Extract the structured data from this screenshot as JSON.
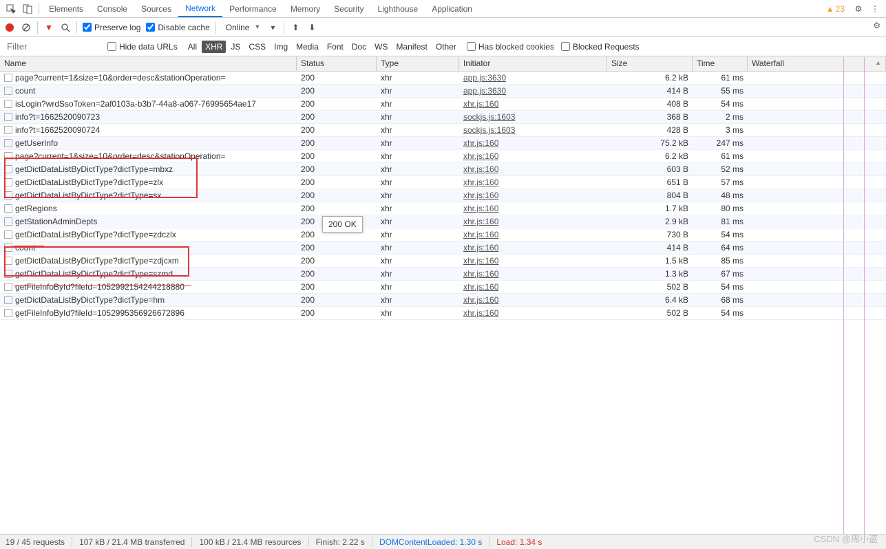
{
  "tabs": {
    "elements": "Elements",
    "console": "Console",
    "sources": "Sources",
    "network": "Network",
    "performance": "Performance",
    "memory": "Memory",
    "security": "Security",
    "lighthouse": "Lighthouse",
    "application": "Application"
  },
  "warnCount": "23",
  "toolbar": {
    "preserve": "Preserve log",
    "disable": "Disable cache",
    "throttle": "Online"
  },
  "filter": {
    "placeholder": "Filter",
    "hideUrls": "Hide data URLs",
    "types": [
      "All",
      "XHR",
      "JS",
      "CSS",
      "Img",
      "Media",
      "Font",
      "Doc",
      "WS",
      "Manifest",
      "Other"
    ],
    "blockedCookies": "Has blocked cookies",
    "blockedRequests": "Blocked Requests"
  },
  "headers": {
    "name": "Name",
    "status": "Status",
    "type": "Type",
    "initiator": "Initiator",
    "size": "Size",
    "time": "Time",
    "waterfall": "Waterfall"
  },
  "rows": [
    {
      "name": "page?current=1&size=10&order=desc&stationOperation=",
      "status": "200",
      "type": "xhr",
      "initiator": "app.js:3630",
      "size": "6.2 kB",
      "time": "61 ms",
      "wfLeft": 4,
      "wfW": 4
    },
    {
      "name": "count",
      "status": "200",
      "type": "xhr",
      "initiator": "app.js:3630",
      "size": "414 B",
      "time": "55 ms",
      "wfLeft": 4,
      "wfW": 3
    },
    {
      "name": "isLogin?wrdSsoToken=2af0103a-b3b7-44a8-a067-76995654ae17",
      "status": "200",
      "type": "xhr",
      "initiator": "xhr.js:160",
      "size": "408 B",
      "time": "54 ms",
      "wfLeft": 4,
      "wfW": 3
    },
    {
      "name": "info?t=1662520090723",
      "status": "200",
      "type": "xhr",
      "initiator": "sockjs.js:1603",
      "size": "368 B",
      "time": "2 ms",
      "wfLeft": 4,
      "wfW": 2
    },
    {
      "name": "info?t=1662520090724",
      "status": "200",
      "type": "xhr",
      "initiator": "sockjs.js:1603",
      "size": "428 B",
      "time": "3 ms",
      "wfLeft": 4,
      "wfW": 2
    },
    {
      "name": "getUserInfo",
      "status": "200",
      "type": "xhr",
      "initiator": "xhr.js:160",
      "size": "75.2 kB",
      "time": "247 ms",
      "wfLeft": 158,
      "wfW": 6
    },
    {
      "name": "page?current=1&size=10&order=desc&stationOperation=",
      "status": "200",
      "type": "xhr",
      "initiator": "xhr.js:160",
      "size": "6.2 kB",
      "time": "61 ms",
      "wfLeft": 176,
      "wfW": 3
    },
    {
      "name": "getDictDataListByDictType?dictType=mbxz",
      "status": "200",
      "type": "xhr",
      "initiator": "xhr.js:160",
      "size": "603 B",
      "time": "52 ms",
      "wfLeft": 176,
      "wfW": 3
    },
    {
      "name": "getDictDataListByDictType?dictType=zlx",
      "status": "200",
      "type": "xhr",
      "initiator": "xhr.js:160",
      "size": "651 B",
      "time": "57 ms",
      "wfLeft": 176,
      "wfW": 3
    },
    {
      "name": "getDictDataListByDictType?dictType=sx",
      "status": "200",
      "type": "xhr",
      "initiator": "xhr.js:160",
      "size": "804 B",
      "time": "48 ms",
      "wfLeft": 176,
      "wfW": 3
    },
    {
      "name": "getRegions",
      "status": "200",
      "type": "xhr",
      "initiator": "xhr.js:160",
      "size": "1.7 kB",
      "time": "80 ms",
      "wfLeft": 176,
      "wfW": 3
    },
    {
      "name": "getStationAdminDepts",
      "status": "200",
      "type": "xhr",
      "initiator": "xhr.js:160",
      "size": "2.9 kB",
      "time": "81 ms",
      "wfLeft": 176,
      "wfW": 3
    },
    {
      "name": "getDictDataListByDictType?dictType=zdczlx",
      "status": "200",
      "type": "xhr",
      "initiator": "xhr.js:160",
      "size": "730 B",
      "time": "54 ms",
      "wfLeft": 176,
      "wfW": 3
    },
    {
      "name": "count",
      "status": "200",
      "type": "xhr",
      "initiator": "xhr.js:160",
      "size": "414 B",
      "time": "64 ms",
      "wfLeft": 176,
      "wfW": 3
    },
    {
      "name": "getDictDataListByDictType?dictType=zdjcxm",
      "status": "200",
      "type": "xhr",
      "initiator": "xhr.js:160",
      "size": "1.5 kB",
      "time": "85 ms",
      "wfLeft": 176,
      "wfW": 3
    },
    {
      "name": "getDictDataListByDictType?dictType=szmd",
      "status": "200",
      "type": "xhr",
      "initiator": "xhr.js:160",
      "size": "1.3 kB",
      "time": "67 ms",
      "wfLeft": 176,
      "wfW": 3
    },
    {
      "name": "getFileInfoById?fileId=1052992154244218880",
      "status": "200",
      "type": "xhr",
      "initiator": "xhr.js:160",
      "size": "502 B",
      "time": "54 ms",
      "wfLeft": 176,
      "wfW": 3
    },
    {
      "name": "getDictDataListByDictType?dictType=hm",
      "status": "200",
      "type": "xhr",
      "initiator": "xhr.js:160",
      "size": "6.4 kB",
      "time": "68 ms",
      "wfLeft": 176,
      "wfW": 3
    },
    {
      "name": "getFileInfoById?fileId=1052995356926672896",
      "status": "200",
      "type": "xhr",
      "initiator": "xhr.js:160",
      "size": "502 B",
      "time": "54 ms",
      "wfLeft": 176,
      "wfW": 3
    }
  ],
  "tooltip": "200 OK",
  "status": {
    "requests": "19 / 45 requests",
    "transferred": "107 kB / 21.4 MB transferred",
    "resources": "100 kB / 21.4 MB resources",
    "finish": "Finish: 2.22 s",
    "domc": "DOMContentLoaded: 1.30 s",
    "load": "Load: 1.34 s"
  },
  "watermark": "CSDN @周小盗"
}
